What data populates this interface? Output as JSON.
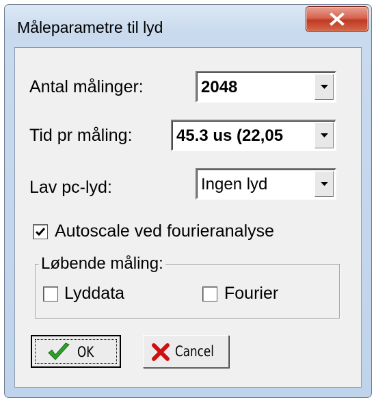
{
  "window": {
    "title": "Måleparametre til lyd"
  },
  "fields": {
    "antal_label": "Antal målinger:",
    "antal_value": "2048",
    "tid_label": "Tid pr måling:",
    "tid_value": "45.3 us (22,05",
    "lyd_label": "Lav pc-lyd:",
    "lyd_value": "Ingen lyd"
  },
  "autoscale": {
    "label": "Autoscale ved fourieranalyse",
    "checked": true
  },
  "group": {
    "legend": "Løbende måling:",
    "lyddata_label": "Lyddata",
    "lyddata_checked": false,
    "fourier_label": "Fourier",
    "fourier_checked": false
  },
  "buttons": {
    "ok_label": "OK",
    "cancel_label": "Cancel"
  },
  "colors": {
    "ok_check": "#2ea02e",
    "cancel_x": "#d01010",
    "close_button": "#c8432a"
  }
}
